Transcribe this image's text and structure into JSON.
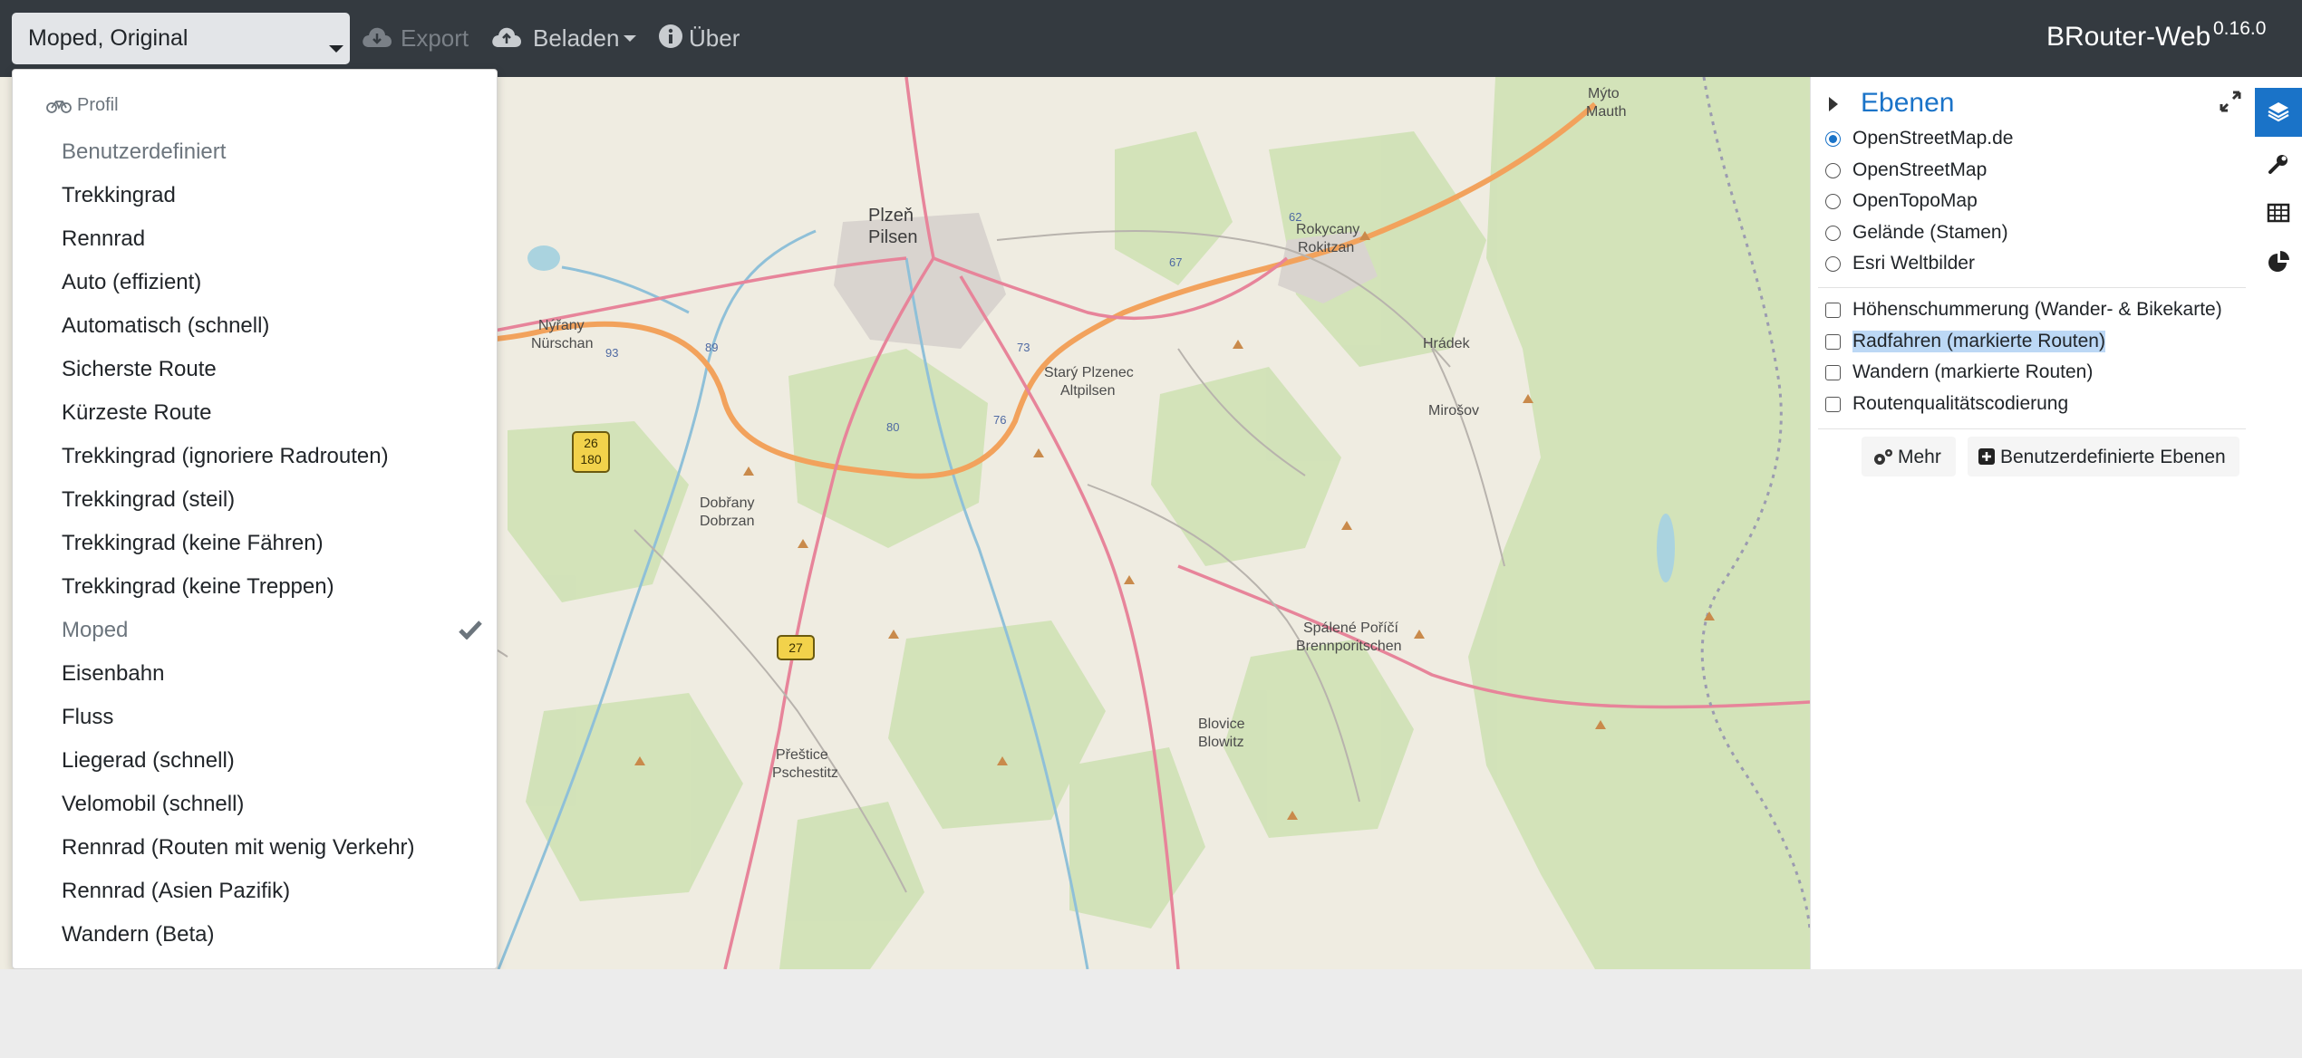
{
  "navbar": {
    "profile_selected": "Moped, Original",
    "export_label": "Export",
    "load_label": "Beladen",
    "about_label": "Über",
    "brand": "BRouter-Web",
    "version": "0.16.0",
    "icons": {
      "export": "cloud-download-icon",
      "load": "cloud-upload-icon",
      "about": "info-circle-icon"
    }
  },
  "profile_menu": {
    "header": "Profil",
    "header_icon": "bicycle-icon",
    "items": [
      {
        "label": "Benutzerdefiniert",
        "state": "muted"
      },
      {
        "label": "Trekkingrad",
        "state": "normal"
      },
      {
        "label": "Rennrad",
        "state": "normal"
      },
      {
        "label": "Auto (effizient)",
        "state": "normal"
      },
      {
        "label": "Automatisch (schnell)",
        "state": "normal"
      },
      {
        "label": "Sicherste Route",
        "state": "normal"
      },
      {
        "label": "Kürzeste Route",
        "state": "normal"
      },
      {
        "label": "Trekkingrad (ignoriere Radrouten)",
        "state": "normal"
      },
      {
        "label": "Trekkingrad (steil)",
        "state": "normal"
      },
      {
        "label": "Trekkingrad (keine Fähren)",
        "state": "normal"
      },
      {
        "label": "Trekkingrad (keine Treppen)",
        "state": "normal"
      },
      {
        "label": "Moped",
        "state": "selected"
      },
      {
        "label": "Eisenbahn",
        "state": "normal"
      },
      {
        "label": "Fluss",
        "state": "normal"
      },
      {
        "label": "Liegerad (schnell)",
        "state": "normal"
      },
      {
        "label": "Velomobil (schnell)",
        "state": "normal"
      },
      {
        "label": "Rennrad (Routen mit wenig Verkehr)",
        "state": "normal"
      },
      {
        "label": "Rennrad (Asien Pazifik)",
        "state": "normal"
      },
      {
        "label": "Wandern (Beta)",
        "state": "normal"
      }
    ]
  },
  "layers_panel": {
    "title": "Ebenen",
    "base_layers": [
      {
        "label": "OpenStreetMap.de",
        "checked": true
      },
      {
        "label": "OpenStreetMap",
        "checked": false
      },
      {
        "label": "OpenTopoMap",
        "checked": false
      },
      {
        "label": "Gelände (Stamen)",
        "checked": false
      },
      {
        "label": "Esri Weltbilder",
        "checked": false
      }
    ],
    "overlays": [
      {
        "label": "Höhenschummerung (Wander- & Bikekarte)",
        "checked": false
      },
      {
        "label": "Radfahren (markierte Routen)",
        "checked": false,
        "highlighted": true
      },
      {
        "label": "Wandern (markierte Routen)",
        "checked": false
      },
      {
        "label": "Routenqualitätscodierung",
        "checked": false
      }
    ],
    "more_button": "Mehr",
    "custom_layers_button": "Benutzerdefinierte Ebenen"
  },
  "tabstrip": [
    {
      "name": "layers-icon",
      "active": true
    },
    {
      "name": "wrench-icon",
      "active": false
    },
    {
      "name": "table-icon",
      "active": false
    },
    {
      "name": "pie-chart-icon",
      "active": false
    }
  ],
  "map": {
    "labels": [
      {
        "text": "Plzeň",
        "big": true
      },
      {
        "text": "Pilsen",
        "big": true
      },
      {
        "text": "Rokycany"
      },
      {
        "text": "Rokitzan"
      },
      {
        "text": "Mýto"
      },
      {
        "text": "Mauth"
      },
      {
        "text": "Nýřany"
      },
      {
        "text": "Nürschan"
      },
      {
        "text": "Starý Plzenec"
      },
      {
        "text": "Altpilsen"
      },
      {
        "text": "Hrádek"
      },
      {
        "text": "Mirošov"
      },
      {
        "text": "Dobřany"
      },
      {
        "text": "Dobrzan"
      },
      {
        "text": "Spálené Poříčí"
      },
      {
        "text": "Brennporitschen"
      },
      {
        "text": "Blovice"
      },
      {
        "text": "Blowitz"
      },
      {
        "text": "Přeštice"
      },
      {
        "text": "Pschestitz"
      }
    ],
    "road_shields": [
      "26",
      "180",
      "27"
    ],
    "road_numbers": [
      "93",
      "89",
      "73",
      "67",
      "62",
      "80",
      "76"
    ]
  }
}
